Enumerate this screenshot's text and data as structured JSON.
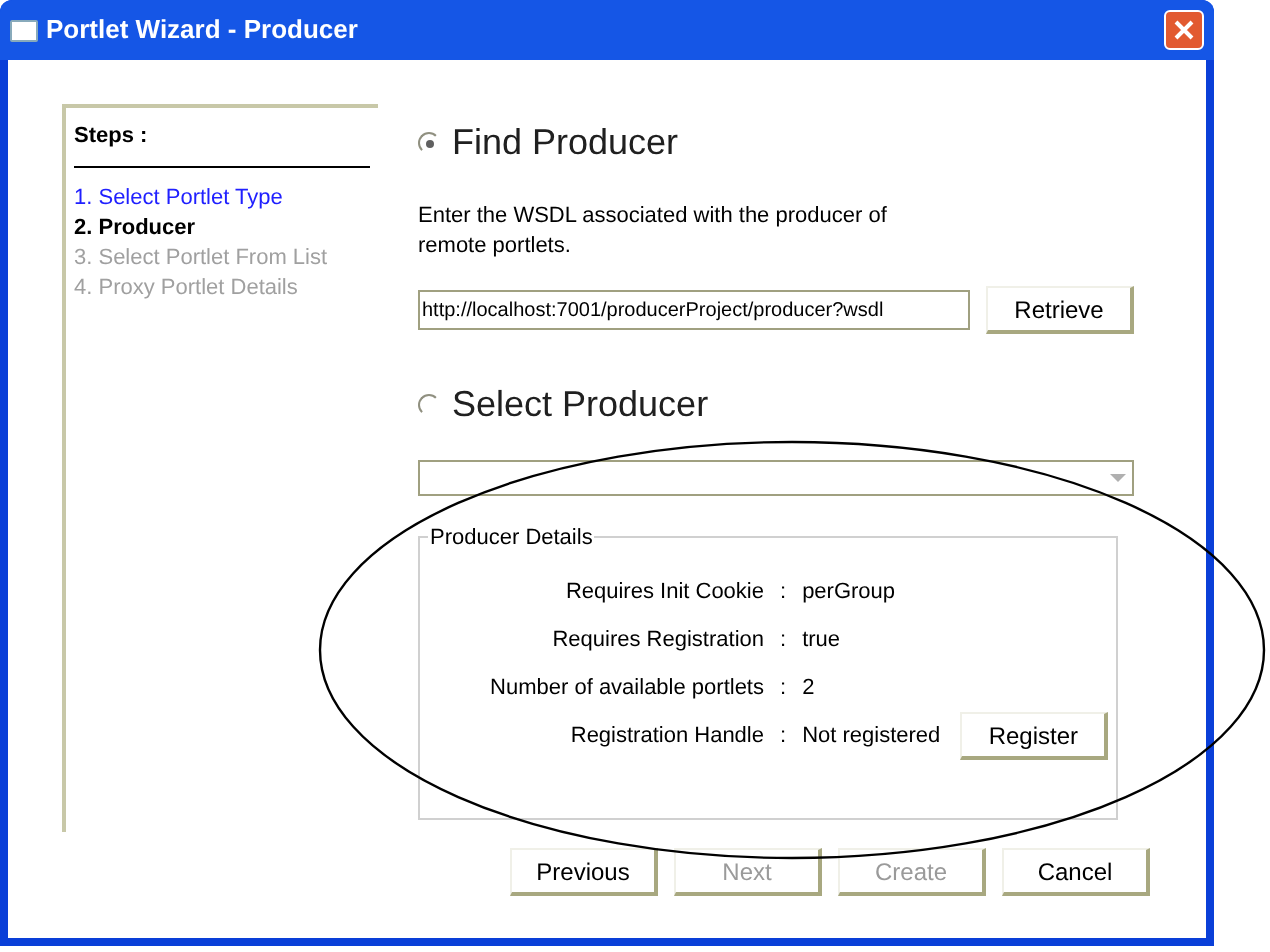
{
  "window": {
    "title": "Portlet Wizard - Producer"
  },
  "steps": {
    "heading": "Steps :",
    "items": [
      {
        "label": "1. Select Portlet Type",
        "selected": false,
        "disabled": false
      },
      {
        "label": "2. Producer",
        "selected": true,
        "disabled": false
      },
      {
        "label": "3. Select Portlet From List",
        "selected": false,
        "disabled": true
      },
      {
        "label": "4. Proxy Portlet Details",
        "selected": false,
        "disabled": true
      }
    ]
  },
  "find_producer": {
    "label": "Find Producer",
    "selected": true,
    "description": "Enter the WSDL associated with the producer of remote portlets.",
    "wsdl": "http://localhost:7001/producerProject/producer?wsdl",
    "button": "Retrieve"
  },
  "select_producer": {
    "label": "Select Producer",
    "selected": false
  },
  "producer_details": {
    "title": "Producer Details",
    "rows": [
      {
        "label": "Requires Init Cookie",
        "separator": ":",
        "value": "perGroup"
      },
      {
        "label": "Requires Registration",
        "separator": ":",
        "value": "true"
      },
      {
        "label": "Number of available portlets",
        "separator": ":",
        "value": "2"
      },
      {
        "label": "Registration Handle",
        "separator": ":",
        "value": "Not registered",
        "button": "Register"
      }
    ]
  },
  "buttons": [
    {
      "label": "Previous",
      "disabled": false
    },
    {
      "label": "Next",
      "disabled": true
    },
    {
      "label": "Create",
      "disabled": true
    },
    {
      "label": "Cancel",
      "disabled": false
    }
  ]
}
